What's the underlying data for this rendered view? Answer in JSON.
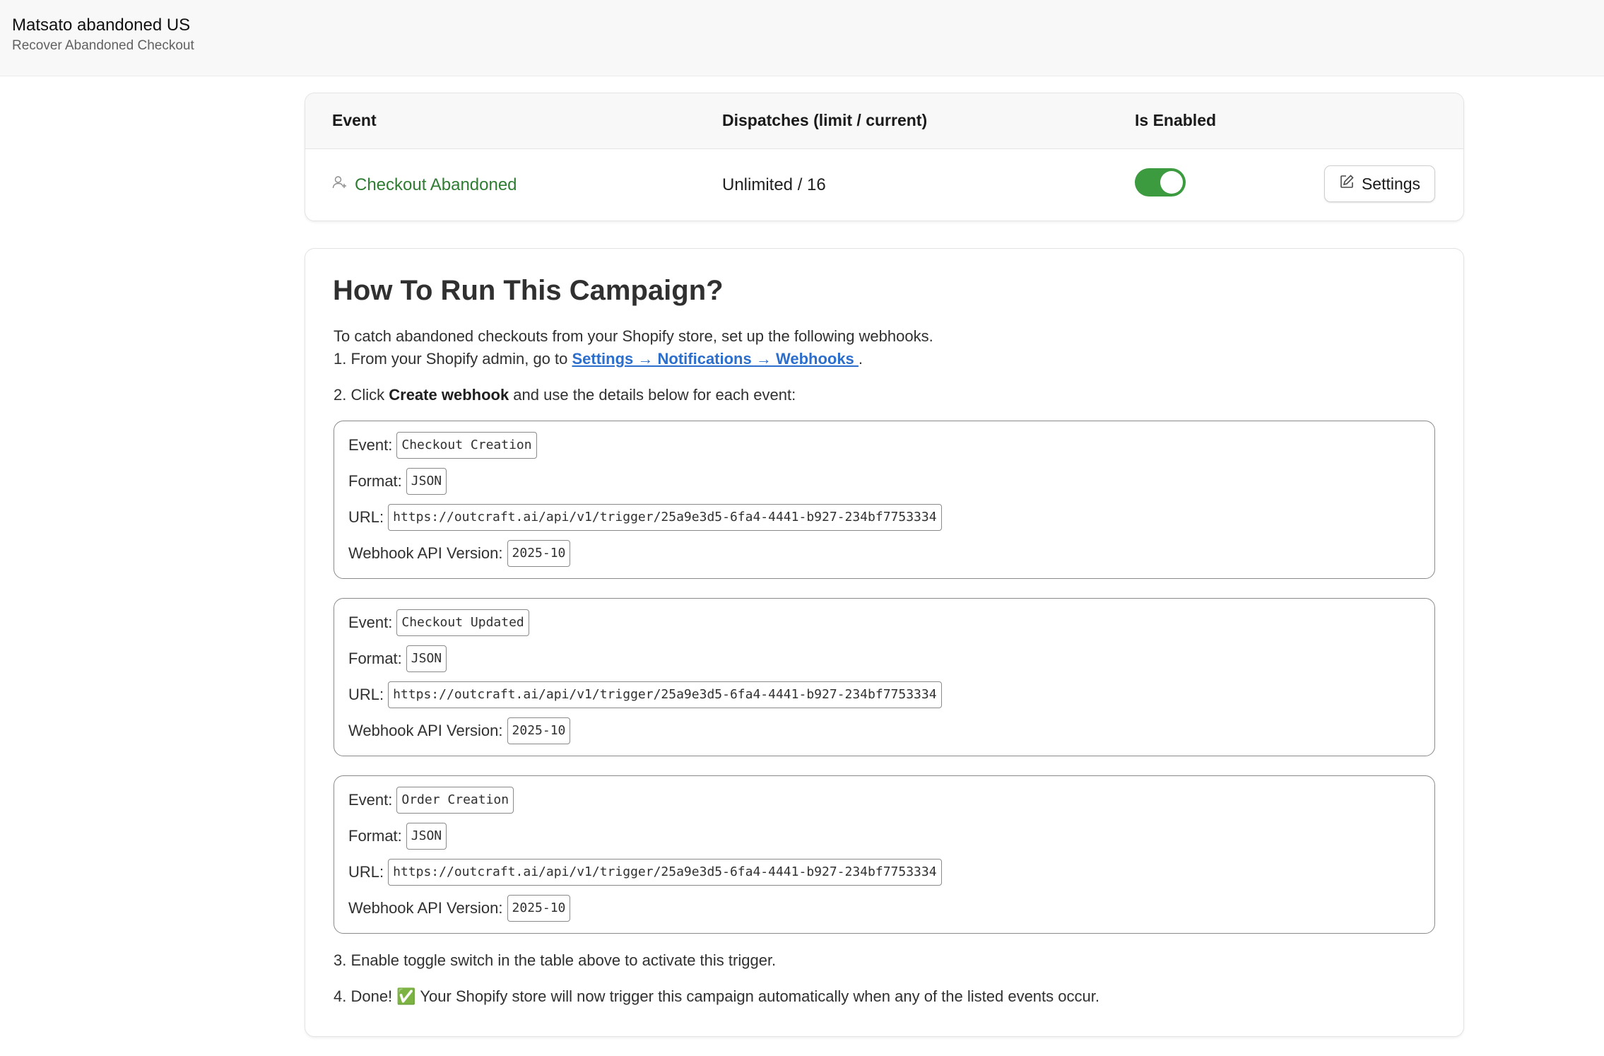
{
  "header": {
    "title": "Matsato abandoned US",
    "subtitle": "Recover Abandoned Checkout"
  },
  "table": {
    "columns": [
      "Event",
      "Dispatches (limit / current)",
      "Is Enabled"
    ],
    "row": {
      "event": "Checkout Abandoned",
      "dispatches": "Unlimited / 16",
      "enabled": true,
      "settings_label": "Settings"
    }
  },
  "howto": {
    "heading": "How To Run This Campaign?",
    "intro": "To catch abandoned checkouts from your Shopify store, set up the following webhooks.",
    "step1_prefix": "1. From your Shopify admin, go to ",
    "step1_link": "Settings → Notifications → Webhooks ",
    "step1_suffix": ".",
    "step2_prefix": "2. Click ",
    "step2_bold": "Create webhook",
    "step2_suffix": " and use the details below for each event:",
    "labels": {
      "event": "Event:",
      "format": "Format:",
      "url": "URL:",
      "version": "Webhook API Version:"
    },
    "webhooks": [
      {
        "event": "Checkout Creation",
        "format": "JSON",
        "url": "https://outcraft.ai/api/v1/trigger/25a9e3d5-6fa4-4441-b927-234bf7753334",
        "version": "2025-10"
      },
      {
        "event": "Checkout Updated",
        "format": "JSON",
        "url": "https://outcraft.ai/api/v1/trigger/25a9e3d5-6fa4-4441-b927-234bf7753334",
        "version": "2025-10"
      },
      {
        "event": "Order Creation",
        "format": "JSON",
        "url": "https://outcraft.ai/api/v1/trigger/25a9e3d5-6fa4-4441-b927-234bf7753334",
        "version": "2025-10"
      }
    ],
    "step3": "3. Enable toggle switch in the table above to activate this trigger.",
    "step4": "4. Done! ✅ Your Shopify store will now trigger this campaign automatically when any of the listed events occur."
  },
  "colors": {
    "accent_green": "#3d9b3f",
    "link_green": "#2f7d33",
    "link_blue": "#2c6ecb"
  }
}
